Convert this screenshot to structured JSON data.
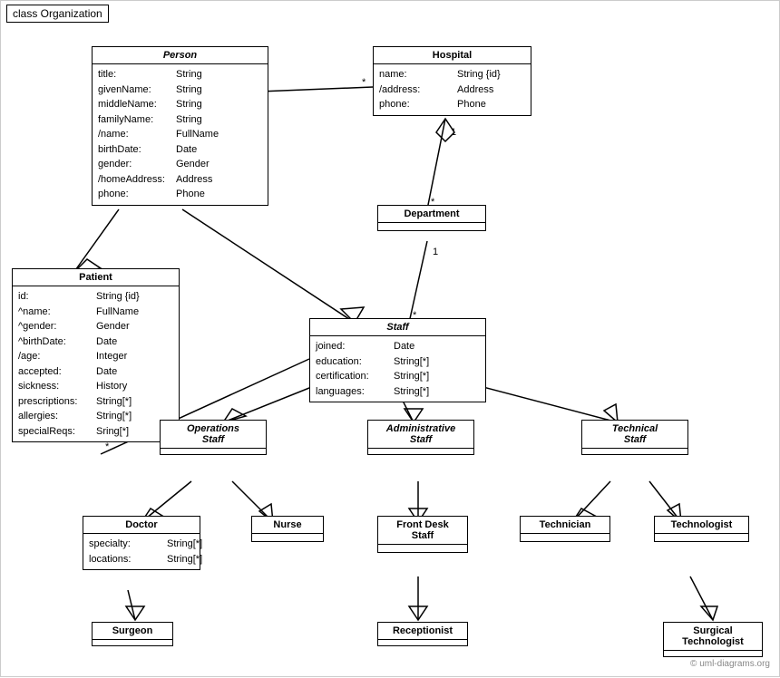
{
  "title": "class Organization",
  "classes": {
    "person": {
      "name": "Person",
      "italic": true,
      "attrs": [
        {
          "name": "title:",
          "type": "String"
        },
        {
          "name": "givenName:",
          "type": "String"
        },
        {
          "name": "middleName:",
          "type": "String"
        },
        {
          "name": "familyName:",
          "type": "String"
        },
        {
          "name": "/name:",
          "type": "FullName"
        },
        {
          "name": "birthDate:",
          "type": "Date"
        },
        {
          "name": "gender:",
          "type": "Gender"
        },
        {
          "name": "/homeAddress:",
          "type": "Address"
        },
        {
          "name": "phone:",
          "type": "Phone"
        }
      ]
    },
    "hospital": {
      "name": "Hospital",
      "italic": false,
      "attrs": [
        {
          "name": "name:",
          "type": "String {id}"
        },
        {
          "name": "/address:",
          "type": "Address"
        },
        {
          "name": "phone:",
          "type": "Phone"
        }
      ]
    },
    "patient": {
      "name": "Patient",
      "italic": false,
      "attrs": [
        {
          "name": "id:",
          "type": "String {id}"
        },
        {
          "name": "^name:",
          "type": "FullName"
        },
        {
          "name": "^gender:",
          "type": "Gender"
        },
        {
          "name": "^birthDate:",
          "type": "Date"
        },
        {
          "name": "/age:",
          "type": "Integer"
        },
        {
          "name": "accepted:",
          "type": "Date"
        },
        {
          "name": "sickness:",
          "type": "History"
        },
        {
          "name": "prescriptions:",
          "type": "String[*]"
        },
        {
          "name": "allergies:",
          "type": "String[*]"
        },
        {
          "name": "specialReqs:",
          "type": "Sring[*]"
        }
      ]
    },
    "department": {
      "name": "Department",
      "italic": false,
      "attrs": []
    },
    "staff": {
      "name": "Staff",
      "italic": true,
      "attrs": [
        {
          "name": "joined:",
          "type": "Date"
        },
        {
          "name": "education:",
          "type": "String[*]"
        },
        {
          "name": "certification:",
          "type": "String[*]"
        },
        {
          "name": "languages:",
          "type": "String[*]"
        }
      ]
    },
    "operations_staff": {
      "name": "Operations Staff",
      "italic": true
    },
    "administrative_staff": {
      "name": "Administrative Staff",
      "italic": true
    },
    "technical_staff": {
      "name": "Technical Staff",
      "italic": true
    },
    "doctor": {
      "name": "Doctor",
      "italic": false,
      "attrs": [
        {
          "name": "specialty:",
          "type": "String[*]"
        },
        {
          "name": "locations:",
          "type": "String[*]"
        }
      ]
    },
    "nurse": {
      "name": "Nurse",
      "italic": false,
      "attrs": []
    },
    "front_desk_staff": {
      "name": "Front Desk Staff",
      "italic": false,
      "attrs": []
    },
    "technician": {
      "name": "Technician",
      "italic": false,
      "attrs": []
    },
    "technologist": {
      "name": "Technologist",
      "italic": false,
      "attrs": []
    },
    "surgeon": {
      "name": "Surgeon",
      "italic": false,
      "attrs": []
    },
    "receptionist": {
      "name": "Receptionist",
      "italic": false,
      "attrs": []
    },
    "surgical_technologist": {
      "name": "Surgical Technologist",
      "italic": false,
      "attrs": []
    }
  },
  "watermark": "© uml-diagrams.org"
}
